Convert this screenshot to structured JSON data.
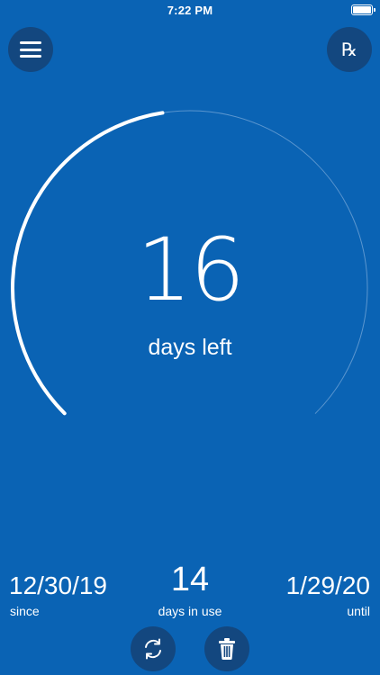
{
  "status_bar": {
    "time": "7:22 PM"
  },
  "header": {
    "menu_icon": "hamburger-menu-icon",
    "rx_label": "℞"
  },
  "countdown": {
    "days_left_value": "16",
    "days_left_label": "days left",
    "progress_fraction": 0.467
  },
  "stats": {
    "since_value": "12/30/19",
    "since_label": "since",
    "in_use_value": "14",
    "in_use_label": "days in use",
    "until_value": "1/29/20",
    "until_label": "until"
  },
  "actions": {
    "refresh_icon": "refresh-icon",
    "trash_icon": "trash-icon"
  },
  "colors": {
    "background": "#0a63b4",
    "button": "#13477f",
    "ring_track": "#5b96cf",
    "ring_progress": "#ffffff"
  }
}
